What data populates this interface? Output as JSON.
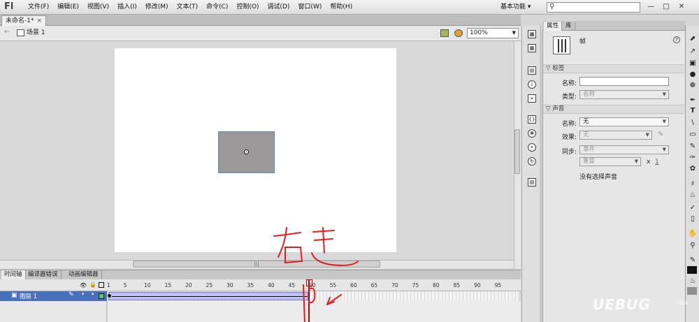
{
  "app": {
    "logo": "Fl"
  },
  "menubar": {
    "items": [
      "文件(F)",
      "编辑(E)",
      "视图(V)",
      "插入(I)",
      "修改(M)",
      "文本(T)",
      "命令(C)",
      "控制(O)",
      "调试(D)",
      "窗口(W)",
      "帮助(H)"
    ],
    "workspace": "基本功能",
    "workspace_arrow": "▾",
    "search_placeholder": ""
  },
  "window_controls": {
    "minimize": "—",
    "restore": "□",
    "close": "✕"
  },
  "document": {
    "tab_title": "未命名-1*",
    "tab_close": "×"
  },
  "editbar": {
    "scene": "场景 1",
    "zoom": "100%"
  },
  "timeline": {
    "tabs": [
      "时间轴",
      "编译器错误",
      "动画编辑器"
    ],
    "ruler_labels": [
      "1",
      "5",
      "10",
      "15",
      "20",
      "25",
      "30",
      "35",
      "40",
      "45",
      "50",
      "55",
      "60",
      "65",
      "70",
      "75",
      "80",
      "85",
      "90",
      "95"
    ],
    "layer_name": "图层 1",
    "current_frame": 50
  },
  "properties": {
    "tabs": [
      "属性",
      "库"
    ],
    "frame_type": "帧",
    "help": "?",
    "label_section": "标签",
    "name_label": "名称:",
    "name_value": "",
    "type_label": "类型:",
    "type_value": "名称",
    "sound_section": "声音",
    "sound_name_label": "名称:",
    "sound_name_value": "无",
    "effect_label": "效果:",
    "effect_value": "无",
    "sync_label": "同步:",
    "sync_value": "事件",
    "repeat_value": "重复",
    "repeat_x": "x",
    "repeat_count": "1",
    "no_sound": "没有选择声音"
  },
  "annotation": {
    "text": "右击"
  },
  "watermark": {
    "text": "UEBUG",
    "sub": "下载站"
  },
  "colors": {
    "stage_bg": "#ffffff",
    "rect_fill": "#9b9899",
    "layer_selected": "#4a6fbd",
    "tween": "#bfc3f3",
    "playhead": "#cc0000",
    "annotation": "#e02020"
  }
}
